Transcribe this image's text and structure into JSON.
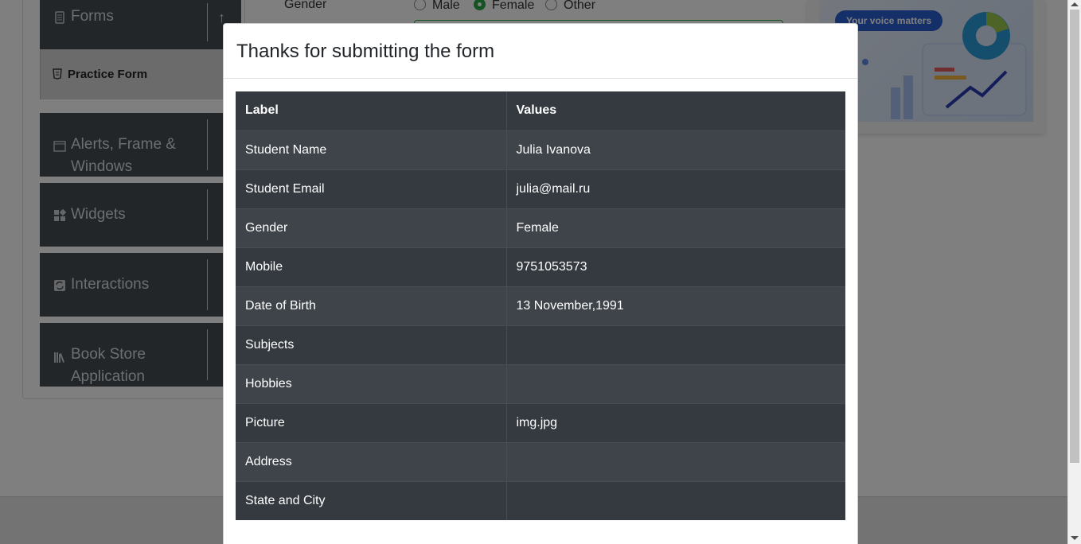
{
  "sidebar": {
    "groups": [
      {
        "label": "Forms",
        "icon": "form-icon"
      },
      {
        "label": "Alerts, Frame & Windows",
        "icon": "window-icon"
      },
      {
        "label": "Widgets",
        "icon": "widgets-icon"
      },
      {
        "label": "Interactions",
        "icon": "interactions-icon"
      },
      {
        "label": "Book Store Application",
        "icon": "books-icon"
      }
    ],
    "active_item": "Practice Form"
  },
  "form": {
    "gender_label": "Gender",
    "gender_options": [
      "Male",
      "Female",
      "Other"
    ],
    "gender_selected": "Female"
  },
  "ad": {
    "pill_text": "Your voice matters"
  },
  "modal": {
    "title": "Thanks for submitting the form",
    "table": {
      "headers": [
        "Label",
        "Values"
      ],
      "rows": [
        [
          "Student Name",
          "Julia Ivanova"
        ],
        [
          "Student Email",
          "julia@mail.ru"
        ],
        [
          "Gender",
          "Female"
        ],
        [
          "Mobile",
          "9751053573"
        ],
        [
          "Date of Birth",
          "13 November,1991"
        ],
        [
          "Subjects",
          ""
        ],
        [
          "Hobbies",
          ""
        ],
        [
          "Picture",
          "img.jpg"
        ],
        [
          "Address",
          ""
        ],
        [
          "State and City",
          ""
        ]
      ]
    }
  },
  "colors": {
    "accent_green": "#28a745",
    "table_dark": "#343a40",
    "sidebar_dark": "#444c52"
  }
}
